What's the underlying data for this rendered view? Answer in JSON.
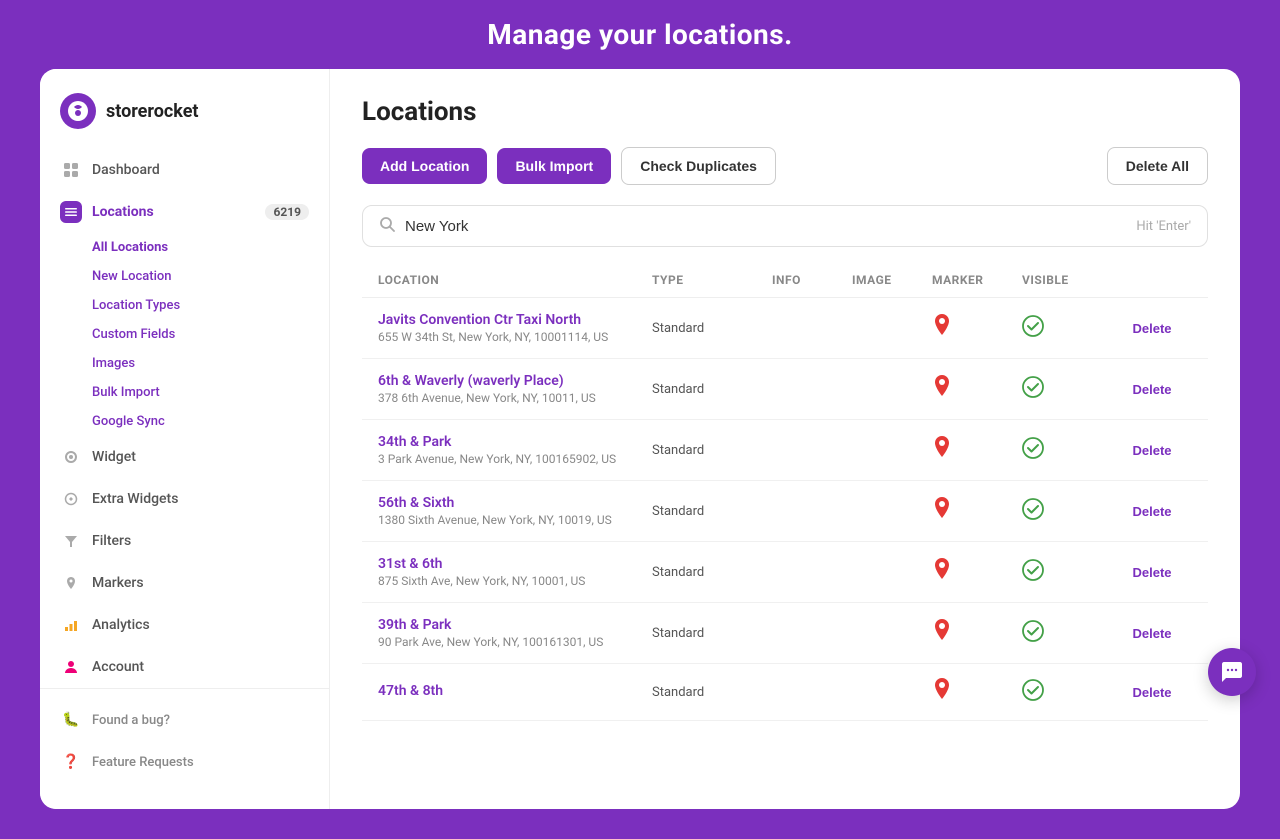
{
  "banner": {
    "text": "Manage your locations."
  },
  "logo": {
    "icon": "P",
    "name": "storerocket"
  },
  "sidebar": {
    "nav_items": [
      {
        "id": "dashboard",
        "label": "Dashboard",
        "icon": "⊞",
        "active": false
      },
      {
        "id": "locations",
        "label": "Locations",
        "icon": "≡",
        "active": true,
        "badge": "6219"
      },
      {
        "id": "widget",
        "label": "Widget",
        "icon": "◈",
        "active": false
      },
      {
        "id": "extra-widgets",
        "label": "Extra Widgets",
        "icon": "🔍",
        "active": false
      },
      {
        "id": "filters",
        "label": "Filters",
        "icon": "▽",
        "active": false
      },
      {
        "id": "markers",
        "label": "Markers",
        "icon": "📍",
        "active": false
      },
      {
        "id": "analytics",
        "label": "Analytics",
        "icon": "📊",
        "active": false
      },
      {
        "id": "account",
        "label": "Account",
        "icon": "👤",
        "active": false
      }
    ],
    "sub_nav": [
      {
        "id": "all-locations",
        "label": "All Locations",
        "active": true
      },
      {
        "id": "new-location",
        "label": "New Location",
        "active": false
      },
      {
        "id": "location-types",
        "label": "Location Types",
        "active": false
      },
      {
        "id": "custom-fields",
        "label": "Custom Fields",
        "active": false
      },
      {
        "id": "images",
        "label": "Images",
        "active": false
      },
      {
        "id": "bulk-import",
        "label": "Bulk Import",
        "active": false
      },
      {
        "id": "google-sync",
        "label": "Google Sync",
        "active": false
      }
    ],
    "bottom_items": [
      {
        "id": "bug",
        "label": "Found a bug?",
        "icon": "🐛"
      },
      {
        "id": "feature",
        "label": "Feature Requests",
        "icon": "❓"
      }
    ]
  },
  "page": {
    "title": "Locations",
    "toolbar": {
      "add_location": "Add Location",
      "bulk_import": "Bulk Import",
      "check_duplicates": "Check Duplicates",
      "delete_all": "Delete All"
    },
    "search": {
      "placeholder": "New York",
      "value": "New York",
      "hint": "Hit 'Enter'"
    },
    "table": {
      "headers": [
        "LOCATION",
        "TYPE",
        "INFO",
        "IMAGE",
        "MARKER",
        "VISIBLE",
        ""
      ],
      "rows": [
        {
          "name": "Javits Convention Ctr Taxi North",
          "address": "655 W 34th St, New York, NY, 10001114, US",
          "type": "Standard",
          "info": "",
          "image": "",
          "marker": "📍",
          "visible": true,
          "delete_label": "Delete"
        },
        {
          "name": "6th & Waverly (waverly Place)",
          "address": "378 6th Avenue, New York, NY, 10011, US",
          "type": "Standard",
          "info": "",
          "image": "",
          "marker": "📍",
          "visible": true,
          "delete_label": "Delete"
        },
        {
          "name": "34th & Park",
          "address": "3 Park Avenue, New York, NY, 100165902, US",
          "type": "Standard",
          "info": "",
          "image": "",
          "marker": "📍",
          "visible": true,
          "delete_label": "Delete"
        },
        {
          "name": "56th & Sixth",
          "address": "1380 Sixth Avenue, New York, NY, 10019, US",
          "type": "Standard",
          "info": "",
          "image": "",
          "marker": "📍",
          "visible": true,
          "delete_label": "Delete"
        },
        {
          "name": "31st & 6th",
          "address": "875 Sixth Ave, New York, NY, 10001, US",
          "type": "Standard",
          "info": "",
          "image": "",
          "marker": "📍",
          "visible": true,
          "delete_label": "Delete"
        },
        {
          "name": "39th & Park",
          "address": "90 Park Ave, New York, NY, 100161301, US",
          "type": "Standard",
          "info": "",
          "image": "",
          "marker": "📍",
          "visible": true,
          "delete_label": "Delete"
        },
        {
          "name": "47th & 8th",
          "address": "",
          "type": "Standard",
          "info": "",
          "image": "",
          "marker": "📍",
          "visible": true,
          "delete_label": "Delete"
        }
      ]
    }
  }
}
